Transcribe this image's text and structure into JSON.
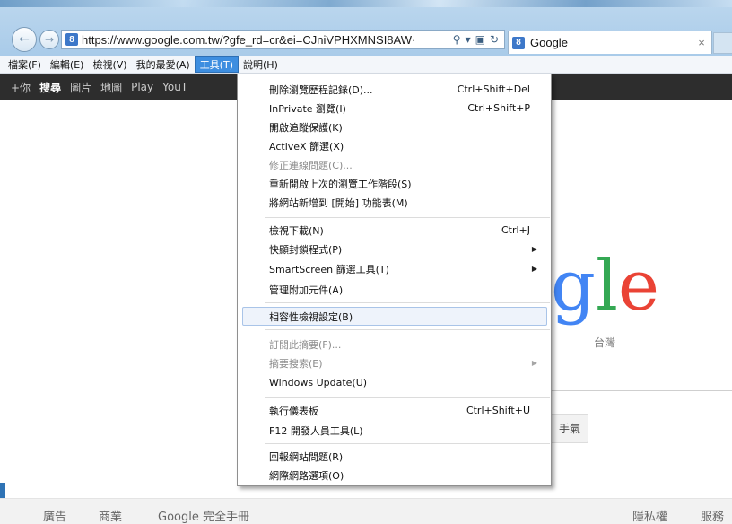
{
  "browser": {
    "url": "https://www.google.com.tw/?gfe_rd=cr&ei=CJniVPHXMNSI8AW·",
    "tab_title": "Google",
    "tab_close": "×",
    "favicon": "8",
    "nav_icons": {
      "back": "back-arrow-icon",
      "forward": "forward-arrow-icon",
      "search": "search-icon",
      "lock": "lock-icon",
      "refresh": "refresh-icon"
    }
  },
  "menubar": {
    "items": [
      {
        "label": "檔案(F)"
      },
      {
        "label": "編輯(E)"
      },
      {
        "label": "檢視(V)"
      },
      {
        "label": "我的最愛(A)"
      },
      {
        "label": "工具(T)"
      },
      {
        "label": "說明(H)"
      }
    ]
  },
  "gbar": {
    "items": [
      "+你",
      "搜尋",
      "圖片",
      "地圖",
      "Play",
      "YouT"
    ]
  },
  "tools_menu": {
    "items": [
      {
        "label": "刪除瀏覽歷程記錄(D)...",
        "shortcut": "Ctrl+Shift+Del"
      },
      {
        "label": "InPrivate 瀏覽(I)",
        "shortcut": "Ctrl+Shift+P"
      },
      {
        "label": "開啟追蹤保護(K)",
        "shortcut": ""
      },
      {
        "label": "ActiveX 篩選(X)",
        "shortcut": ""
      },
      {
        "label": "修正連線問題(C)...",
        "shortcut": ""
      },
      {
        "label": "重新開啟上次的瀏覽工作階段(S)",
        "shortcut": ""
      },
      {
        "label": "將網站新增到 [開始] 功能表(M)",
        "shortcut": ""
      },
      {
        "label": "檢視下載(N)",
        "shortcut": "Ctrl+J"
      },
      {
        "label": "快顯封鎖程式(P)",
        "shortcut": ""
      },
      {
        "label": "SmartScreen 篩選工具(T)",
        "shortcut": ""
      },
      {
        "label": "管理附加元件(A)",
        "shortcut": ""
      },
      {
        "label": "相容性檢視設定(B)",
        "shortcut": ""
      },
      {
        "label": "訂閱此摘要(F)...",
        "shortcut": ""
      },
      {
        "label": "摘要搜索(E)",
        "shortcut": ""
      },
      {
        "label": "Windows Update(U)",
        "shortcut": ""
      },
      {
        "label": "執行儀表板",
        "shortcut": "Ctrl+Shift+U"
      },
      {
        "label": "F12 開發人員工具(L)",
        "shortcut": ""
      },
      {
        "label": "回報網站問題(R)",
        "shortcut": ""
      },
      {
        "label": "網際網路選項(O)",
        "shortcut": ""
      }
    ],
    "submenu_arrow": "▶"
  },
  "page": {
    "logo_visible": "gle",
    "logo_region": "台灣",
    "lucky_button_partial": "手氣"
  },
  "footer": {
    "left": [
      "廣告",
      "商業",
      "Google 完全手冊"
    ],
    "right": [
      "隱私權",
      "服務"
    ]
  },
  "colors": {
    "menu_active": "#3d8ee0",
    "gbar_bg": "#2d2d2d",
    "logo_blue": "#4285f4",
    "logo_green": "#34a853",
    "logo_red": "#ea4335"
  }
}
